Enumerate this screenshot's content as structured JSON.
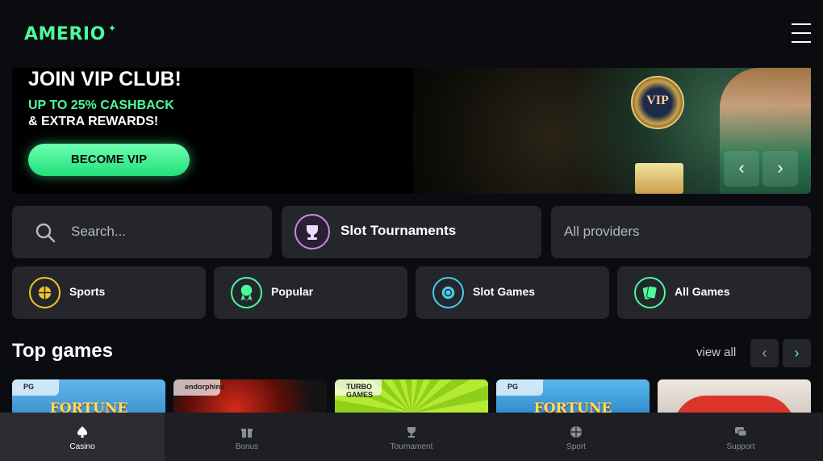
{
  "header": {
    "logo": "AMERIO",
    "logo_star": "✦"
  },
  "banner": {
    "title": "JOIN VIP CLUB!",
    "line1": "UP TO 25% CASHBACK",
    "line2": "& EXTRA REWARDS!",
    "button": "BECOME VIP",
    "coin_text": "VIP",
    "prev": "‹",
    "next": "›"
  },
  "search": {
    "placeholder": "Search..."
  },
  "tournaments": {
    "label": "Slot Tournaments"
  },
  "providers": {
    "label": "All providers"
  },
  "categories": [
    {
      "label": "Sports",
      "color": "#f3c623"
    },
    {
      "label": "Popular",
      "color": "#4dfa9a"
    },
    {
      "label": "Slot Games",
      "color": "#4cc9f0"
    },
    {
      "label": "All Games",
      "color": "#4dfa9a"
    }
  ],
  "top_games": {
    "title": "Top games",
    "view_all": "view all",
    "prev": "‹",
    "next": "›",
    "tiles": [
      {
        "tag": "PG",
        "name": "FORTUNE",
        "bg": "#3a9fd8"
      },
      {
        "tag": "endorphina",
        "name": "",
        "bg": "#1a1a1a"
      },
      {
        "tag": "TURBO GAMES",
        "name": "",
        "bg": "#a6e12a"
      },
      {
        "tag": "PG",
        "name": "FORTUNE",
        "bg": "#2b8fd0"
      },
      {
        "tag": "",
        "name": "",
        "bg": "#d8d0c8"
      }
    ]
  },
  "bottom_nav": [
    {
      "label": "Casino",
      "icon": "spade-icon",
      "active": true
    },
    {
      "label": "Bonus",
      "icon": "gift-icon",
      "active": false
    },
    {
      "label": "Tournament",
      "icon": "trophy-icon",
      "active": false
    },
    {
      "label": "Sport",
      "icon": "ball-icon",
      "active": false
    },
    {
      "label": "Support",
      "icon": "chat-icon",
      "active": false
    }
  ]
}
